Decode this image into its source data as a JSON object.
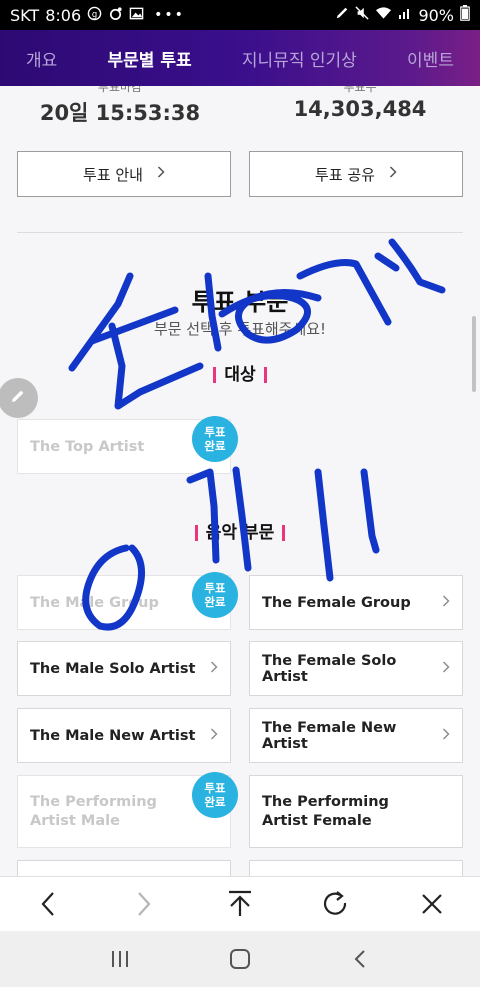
{
  "status_bar": {
    "carrier": "SKT",
    "time": "8:06",
    "battery": "90%",
    "icons_left": [
      "g-badge-icon",
      "camera-icon",
      "image-icon",
      "more-icon"
    ],
    "icons_right": [
      "stylus-icon",
      "mute-icon",
      "wifi-icon",
      "signal-icon",
      "battery-icon"
    ]
  },
  "tabs": [
    {
      "label": "개요",
      "active": false
    },
    {
      "label": "부문별 투표",
      "active": true
    },
    {
      "label": "지니뮤직 인기상",
      "active": false
    },
    {
      "label": "이벤트",
      "active": false
    }
  ],
  "stats": {
    "deadline_label": "투표마감",
    "deadline_value": "20일 15:53:38",
    "votes_label": "투표수",
    "votes_value": "14,303,484"
  },
  "buttons": {
    "guide": "투표 안내",
    "share": "투표 공유"
  },
  "section": {
    "title": "투표 부문",
    "subtitle": "부문 선택 후 투표해주세요!"
  },
  "categories": {
    "grand": {
      "label": "대상",
      "items": [
        {
          "name": "The Top Artist",
          "voted": true
        }
      ]
    },
    "music": {
      "label": "음악 부문",
      "items": [
        {
          "name": "The Male Group",
          "voted": true
        },
        {
          "name": "The Female Group",
          "voted": false
        },
        {
          "name": "The Male Solo Artist",
          "voted": false
        },
        {
          "name": "The Female Solo Artist",
          "voted": false
        },
        {
          "name": "The Male New Artist",
          "voted": false
        },
        {
          "name": "The Female New Artist",
          "voted": false
        },
        {
          "name": "The Performing Artist Male",
          "line1": "The Performing",
          "line2": "Artist Male",
          "voted": true
        },
        {
          "name": "The Performing Artist Female",
          "line1": "The Performing",
          "line2": "Artist Female",
          "voted": false
        }
      ]
    }
  },
  "badge": {
    "line1": "투표",
    "line2": "완료"
  },
  "browser_toolbar": [
    "back-icon",
    "forward-icon",
    "scroll-top-icon",
    "reload-icon",
    "close-icon"
  ],
  "system_nav": [
    "recent-apps-icon",
    "home-icon",
    "back-icon"
  ],
  "colors": {
    "tab_gradient_start": "#2d0a73",
    "tab_gradient_end": "#7a1f86",
    "badge": "#2ab3e0",
    "accent_bar": "#e8357c",
    "handwriting": "#1236c8"
  }
}
